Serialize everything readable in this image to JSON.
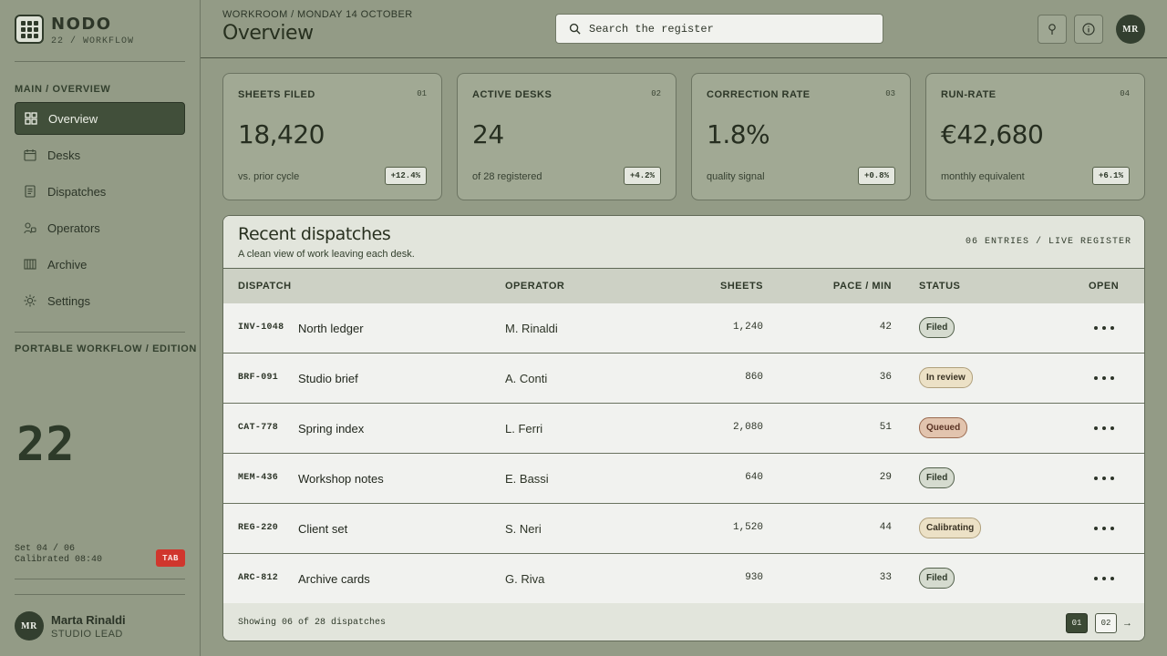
{
  "brand": {
    "name": "NODO",
    "subtitle": "22 / WORKFLOW"
  },
  "sidebar": {
    "section_main": "MAIN / OVERVIEW",
    "items": [
      {
        "label": "Overview",
        "icon": "grid-icon",
        "active": true
      },
      {
        "label": "Desks",
        "icon": "calendar-icon",
        "active": false
      },
      {
        "label": "Dispatches",
        "icon": "document-icon",
        "active": false
      },
      {
        "label": "Operators",
        "icon": "users-icon",
        "active": false
      },
      {
        "label": "Archive",
        "icon": "archive-icon",
        "active": false
      },
      {
        "label": "Settings",
        "icon": "gear-icon",
        "active": false
      }
    ],
    "section_edition": "PORTABLE WORKFLOW / EDITION",
    "big_number": "22",
    "set_line": "Set 04 / 06",
    "calibrated_line": "Calibrated 08:40",
    "tab_badge": "TAB",
    "user": {
      "initials": "MR",
      "name": "Marta Rinaldi",
      "role": "STUDIO LEAD"
    }
  },
  "header": {
    "breadcrumb": "WORKROOM / MONDAY 14 OCTOBER",
    "title": "Overview",
    "search_placeholder": "Search the register",
    "avatar_initials": "MR"
  },
  "stats": [
    {
      "label": "SHEETS FILED",
      "index": "01",
      "value": "18,420",
      "note": "vs. prior cycle",
      "delta": "+12.4%"
    },
    {
      "label": "ACTIVE DESKS",
      "index": "02",
      "value": "24",
      "note": "of 28 registered",
      "delta": "+4.2%"
    },
    {
      "label": "CORRECTION RATE",
      "index": "03",
      "value": "1.8%",
      "note": "quality signal",
      "delta": "+0.8%"
    },
    {
      "label": "RUN-RATE",
      "index": "04",
      "value": "€42,680",
      "note": "monthly equivalent",
      "delta": "+6.1%"
    }
  ],
  "dispatches": {
    "title": "Recent dispatches",
    "subtitle": "A clean view of work leaving each desk.",
    "count_label": "06 ENTRIES / LIVE REGISTER",
    "columns": {
      "dispatch": "DISPATCH",
      "operator": "OPERATOR",
      "sheets": "SHEETS",
      "pace": "PACE / MIN",
      "status": "STATUS",
      "open": "OPEN"
    },
    "rows": [
      {
        "code": "INV-1048",
        "name": "North ledger",
        "operator": "M. Rinaldi",
        "sheets": "1,240",
        "pace": "42",
        "status": "Filed",
        "status_kind": "filed"
      },
      {
        "code": "BRF-091",
        "name": "Studio brief",
        "operator": "A. Conti",
        "sheets": "860",
        "pace": "36",
        "status": "In review",
        "status_kind": "review"
      },
      {
        "code": "CAT-778",
        "name": "Spring index",
        "operator": "L. Ferri",
        "sheets": "2,080",
        "pace": "51",
        "status": "Queued",
        "status_kind": "queued"
      },
      {
        "code": "MEM-436",
        "name": "Workshop notes",
        "operator": "E. Bassi",
        "sheets": "640",
        "pace": "29",
        "status": "Filed",
        "status_kind": "filed"
      },
      {
        "code": "REG-220",
        "name": "Client set",
        "operator": "S. Neri",
        "sheets": "1,520",
        "pace": "44",
        "status": "Calibrating",
        "status_kind": "cal"
      },
      {
        "code": "ARC-812",
        "name": "Archive cards",
        "operator": "G. Riva",
        "sheets": "930",
        "pace": "33",
        "status": "Filed",
        "status_kind": "filed"
      }
    ],
    "footer": "Showing 06 of 28 dispatches",
    "pages": [
      "01",
      "02"
    ],
    "next": "→"
  }
}
